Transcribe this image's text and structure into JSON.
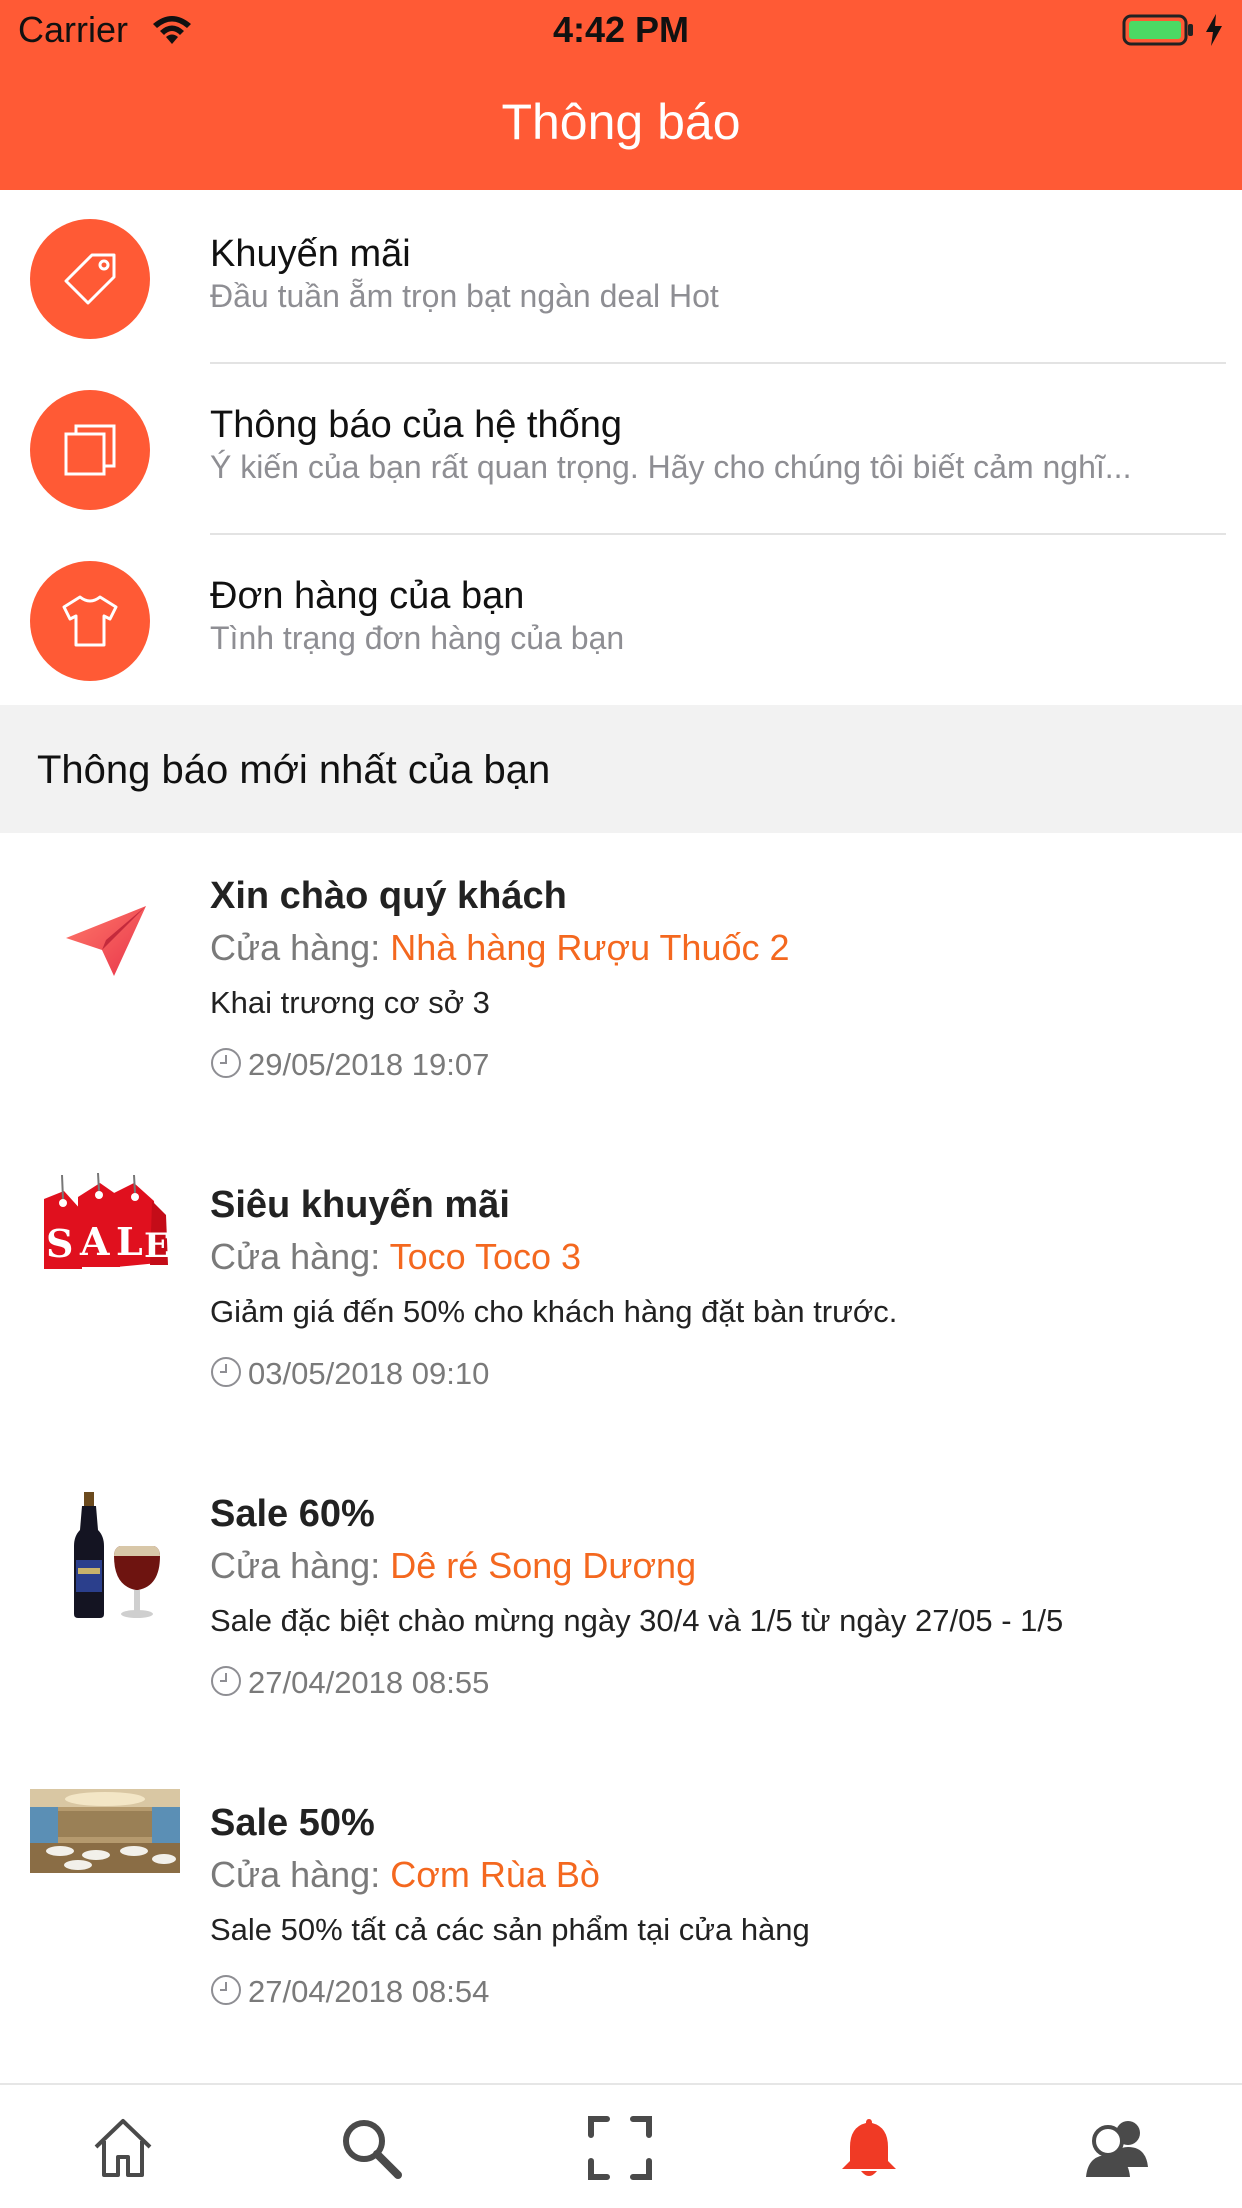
{
  "status_bar": {
    "carrier": "Carrier",
    "time": "4:42 PM",
    "wifi_icon": "wifi-icon",
    "battery_icon": "battery-charging-icon"
  },
  "header": {
    "title": "Thông báo",
    "background_color": "#ff5a35"
  },
  "categories": [
    {
      "title": "Khuyến mãi",
      "subtitle": "Đầu tuần ẵm trọn bạt ngàn deal Hot",
      "icon": "tag-icon"
    },
    {
      "title": "Thông báo của hệ thống",
      "subtitle": "Ý kiến của bạn rất quan trọng. Hãy cho chúng tôi biết cảm nghĩ...",
      "icon": "copy-icon"
    },
    {
      "title": "Đơn hàng của bạn",
      "subtitle": "Tình trạng đơn hàng của bạn",
      "icon": "tshirt-icon"
    }
  ],
  "section": {
    "title": "Thông báo mới nhất của bạn"
  },
  "notifications": [
    {
      "title": "Xin chào quý khách",
      "store_label": "Cửa hàng:",
      "store_name": "Nhà hàng Rượu Thuốc 2",
      "body": "Khai trương cơ sở 3",
      "time": "29/05/2018 19:07",
      "thumb": "paper-plane-icon"
    },
    {
      "title": "Siêu khuyến mãi",
      "store_label": "Cửa hàng:",
      "store_name": "Toco Toco 3",
      "body": "Giảm giá đến 50% cho khách hàng đặt bàn trước.",
      "time": "03/05/2018 09:10",
      "thumb": "sale-tags-image"
    },
    {
      "title": "Sale 60%",
      "store_label": "Cửa hàng:",
      "store_name": "Dê ré Song Dương",
      "body": "Sale đặc biệt chào mừng ngày 30/4 và 1/5 từ ngày 27/05 - 1/5",
      "time": "27/04/2018 08:55",
      "thumb": "beer-bottle-glass-image"
    },
    {
      "title": "Sale 50%",
      "store_label": "Cửa hàng:",
      "store_name": "Cơm Rùa Bò",
      "body": "Sale 50% tất cả các sản phẩm tại cửa hàng",
      "time": "27/04/2018 08:54",
      "thumb": "restaurant-interior-image"
    }
  ],
  "tab_bar": {
    "tabs": [
      "home-icon",
      "search-icon",
      "scan-icon",
      "bell-icon",
      "users-icon"
    ],
    "active": "bell-icon",
    "active_color": "#f03a25",
    "inactive_color": "#4a4a4a"
  },
  "colors": {
    "accent": "#ff5a35",
    "store_name": "#f4681f",
    "secondary_text": "#8e8e93"
  }
}
